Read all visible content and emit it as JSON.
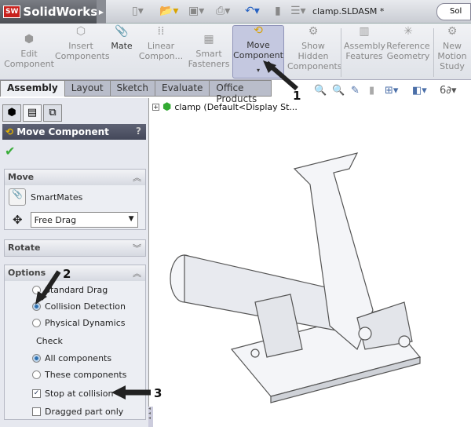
{
  "app": {
    "logo_badge": "SW",
    "logo_text": "SolidWorks",
    "document": "clamp.SLDASM *",
    "search_text": "Sol"
  },
  "ribbon": {
    "buttons": [
      {
        "label": "Edit Component",
        "icon": "edit-component-icon"
      },
      {
        "label": "Insert Components",
        "icon": "insert-components-icon"
      },
      {
        "label": "Mate",
        "icon": "paperclip-icon"
      },
      {
        "label": "Linear Compon...",
        "icon": "linear-pattern-icon"
      },
      {
        "label": "Smart Fasteners",
        "icon": "smart-fasteners-icon"
      },
      {
        "label": "Move Component",
        "icon": "move-component-icon",
        "active": true
      },
      {
        "label": "Show Hidden Components",
        "icon": "show-hidden-icon"
      },
      {
        "label": "Assembly Features",
        "icon": "assembly-features-icon"
      },
      {
        "label": "Reference Geometry",
        "icon": "reference-geometry-icon"
      },
      {
        "label": "New Motion Study",
        "icon": "motion-study-icon"
      }
    ]
  },
  "tabs": [
    "Assembly",
    "Layout",
    "Sketch",
    "Evaluate",
    "Office Products"
  ],
  "panel": {
    "title": "Move Component",
    "help": "?",
    "move": {
      "title": "Move",
      "smartmates": "SmartMates",
      "mode": "Free Drag"
    },
    "rotate": {
      "title": "Rotate"
    },
    "options": {
      "title": "Options",
      "standard": "Standard Drag",
      "collision": "Collision Detection",
      "physical": "Physical Dynamics",
      "check": "Check",
      "all": "All components",
      "these": "These components",
      "stop": "Stop at collision",
      "dragged": "Dragged part only",
      "selected_mode": "Collision Detection",
      "selected_check": "All components",
      "stop_checked": true,
      "dragged_checked": false
    }
  },
  "tree": {
    "expand": "+",
    "label": "clamp  (Default<Display St..."
  },
  "callouts": [
    "1",
    "2",
    "3"
  ],
  "colors": {
    "accent": "#c4c8e0",
    "header": "#4e5264"
  }
}
